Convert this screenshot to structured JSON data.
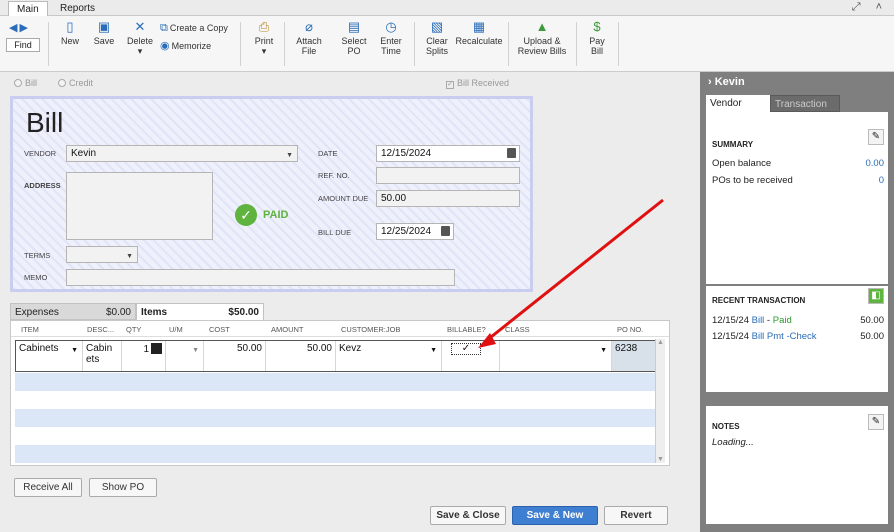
{
  "tabs": {
    "main": "Main",
    "reports": "Reports"
  },
  "toolbar": {
    "find": "Find",
    "new": "New",
    "save": "Save",
    "delete": "Delete",
    "create_copy": "Create a Copy",
    "memorize": "Memorize",
    "print": "Print",
    "attach": "Attach\nFile",
    "select_po": "Select\nPO",
    "enter_time": "Enter\nTime",
    "clear_splits": "Clear\nSplits",
    "recalculate": "Recalculate",
    "upload": "Upload &\nReview Bills",
    "pay_bill": "Pay\nBill"
  },
  "form": {
    "radio_bill": "Bill",
    "radio_credit": "Credit",
    "bill_received": "Bill Received",
    "title": "Bill",
    "vendor_label": "VENDOR",
    "vendor": "Kevin",
    "address_label": "ADDRESS",
    "date_label": "DATE",
    "date": "12/15/2024",
    "refno_label": "REF. NO.",
    "refno": "",
    "amount_due_label": "AMOUNT DUE",
    "amount_due": "50.00",
    "bill_due_label": "BILL DUE",
    "bill_due": "12/25/2024",
    "terms_label": "TERMS",
    "memo_label": "MEMO",
    "paid": "PAID"
  },
  "grid_tabs": {
    "expenses": "Expenses",
    "expenses_amt": "$0.00",
    "items": "Items",
    "items_amt": "$50.00"
  },
  "columns": [
    "ITEM",
    "DESC...",
    "QTY",
    "U/M",
    "COST",
    "AMOUNT",
    "CUSTOMER:JOB",
    "BILLABLE?",
    "CLASS",
    "PO NO."
  ],
  "line": {
    "item": "Cabinets",
    "desc": "Cabin ets",
    "qty": "1",
    "um": "",
    "cost": "50.00",
    "amount": "50.00",
    "customer": "Kevz",
    "billable_mark": "✓",
    "class": "",
    "po": "6238"
  },
  "buttons": {
    "receive_all": "Receive All",
    "show_po": "Show PO",
    "save_close": "Save & Close",
    "save_new": "Save & New",
    "revert": "Revert"
  },
  "side": {
    "name": "Kevin",
    "tab_vendor": "Vendor",
    "tab_transaction": "Transaction",
    "summary_title": "SUMMARY",
    "open_balance_label": "Open balance",
    "open_balance": "0.00",
    "pos_label": "POs to be received",
    "pos": "0",
    "recent_title": "RECENT TRANSACTION",
    "recent": [
      {
        "date": "12/15/24",
        "type": "Bill",
        "sep": " - ",
        "status": "Paid",
        "amount": "50.00"
      },
      {
        "date": "12/15/24",
        "type": "Bill Pmt -Check",
        "sep": "",
        "status": "",
        "amount": "50.00"
      }
    ],
    "notes_title": "NOTES",
    "notes": "Loading..."
  }
}
